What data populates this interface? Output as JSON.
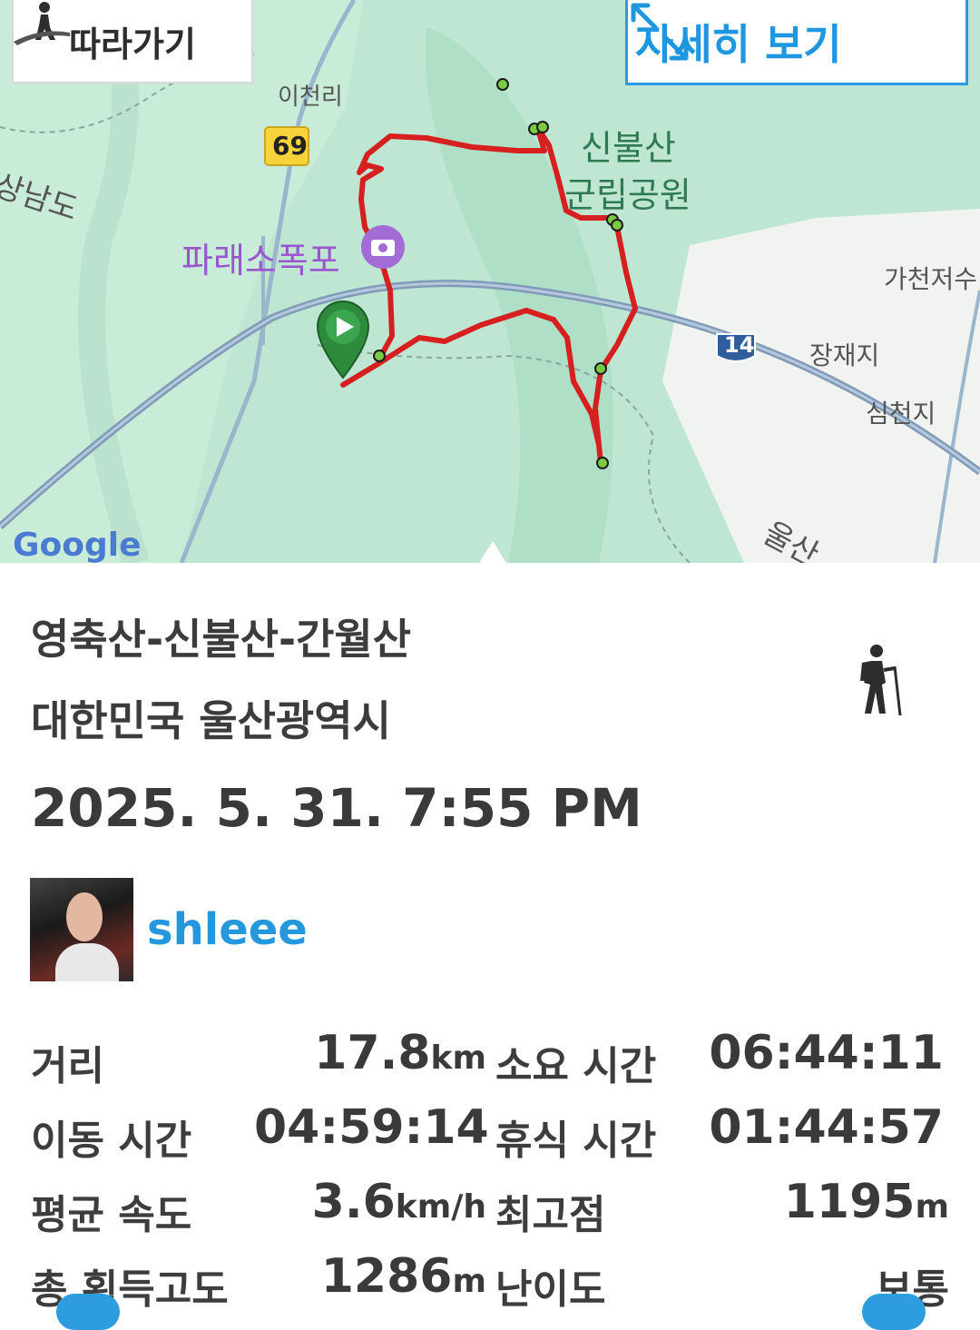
{
  "map": {
    "follow_label": "따라가기",
    "detail_label": "자세히 보기",
    "labels": {
      "icheonri": "이천리",
      "road69": "69",
      "park": "신불산",
      "park2": "군립공원",
      "waterfall": "파래소폭포",
      "gacheon": "가천저수",
      "road14": "14",
      "jangjae": "장재지",
      "simcheon": "심천지",
      "gyeongnam": "상남도",
      "ulsan": "울산",
      "google": "Google"
    }
  },
  "track": {
    "title": "영축산-신불산-간월산",
    "location": "대한민국 울산광역시",
    "datetime": "2025. 5. 31. 7:55 PM",
    "user": "shleee"
  },
  "stats": {
    "distance_label": "거리",
    "distance_value": "17.8",
    "distance_unit": "km",
    "duration_label": "소요 시간",
    "duration_value": "06:44:11",
    "moving_label": "이동 시간",
    "moving_value": "04:59:14",
    "rest_label": "휴식 시간",
    "rest_value": "01:44:57",
    "speed_label": "평균 속도",
    "speed_value": "3.6",
    "speed_unit": "km/h",
    "peak_label": "최고점",
    "peak_value": "1195",
    "peak_unit": "m",
    "gain_label": "총 획득고도",
    "gain_value": "1286",
    "gain_unit": "m",
    "difficulty_label": "난이도",
    "difficulty_value": "보통"
  },
  "colors": {
    "accent": "#2497dd",
    "route": "#d61f1f",
    "map_green": "#bfe6d3"
  }
}
